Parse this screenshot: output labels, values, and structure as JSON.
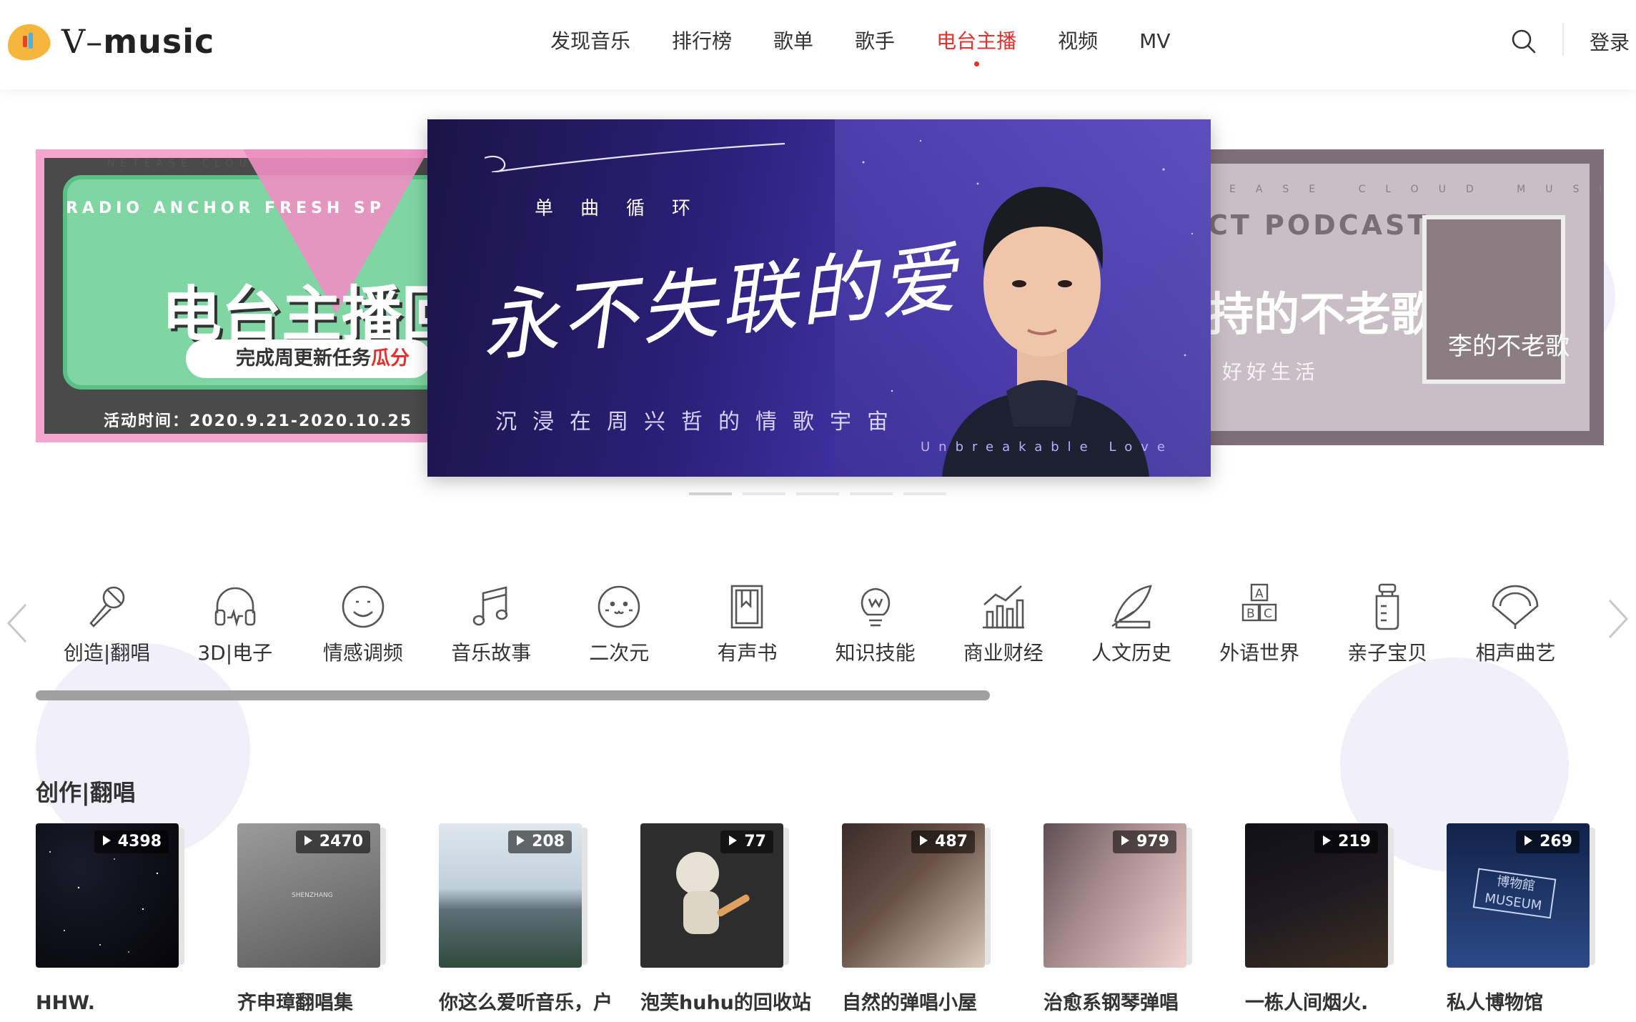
{
  "header": {
    "logo_text_a": "V–",
    "logo_text_b": "music",
    "nav": [
      {
        "label": "发现音乐",
        "active": false
      },
      {
        "label": "排行榜",
        "active": false
      },
      {
        "label": "歌单",
        "active": false
      },
      {
        "label": "歌手",
        "active": false
      },
      {
        "label": "电台主播",
        "active": true
      },
      {
        "label": "视频",
        "active": false
      },
      {
        "label": "MV",
        "active": false
      }
    ],
    "search_icon": "search-icon",
    "login_label": "登录"
  },
  "carousel": {
    "left": {
      "stripe": "NETEASE CLOUD MUSIC",
      "small": "RADIO ANCHOR FRESH SP",
      "big": "电台主播回",
      "pill_a": "完成周更新任务",
      "pill_b": "瓜分",
      "date": "活动时间：2020.9.21-2020.10.25"
    },
    "center": {
      "subtitle": "单曲循环",
      "title": "永不失联的爱",
      "tagline": "沉浸在周兴哲的情歌宇宙",
      "english": "Unbreakable Love"
    },
    "right": {
      "stripe": "EASE CLOUD MUSIC",
      "podcast": "CT PODCAST",
      "song": "持的不老歌",
      "life": "好好生活",
      "cover_text": "李的不老歌"
    },
    "dots": 5,
    "active_dot": 0
  },
  "categories": [
    {
      "label": "创造|翻唱",
      "icon": "microphone-icon"
    },
    {
      "label": "3D|电子",
      "icon": "headphones-icon"
    },
    {
      "label": "情感调频",
      "icon": "smile-icon"
    },
    {
      "label": "音乐故事",
      "icon": "music-note-icon"
    },
    {
      "label": "二次元",
      "icon": "anime-face-icon"
    },
    {
      "label": "有声书",
      "icon": "book-icon"
    },
    {
      "label": "知识技能",
      "icon": "lightbulb-icon"
    },
    {
      "label": "商业财经",
      "icon": "chart-icon"
    },
    {
      "label": "人文历史",
      "icon": "quill-icon"
    },
    {
      "label": "外语世界",
      "icon": "abc-blocks-icon"
    },
    {
      "label": "亲子宝贝",
      "icon": "bottle-icon"
    },
    {
      "label": "相声曲艺",
      "icon": "fan-icon"
    }
  ],
  "section": {
    "title": "创作|翻唱",
    "cards": [
      {
        "count": "4398",
        "title": "HHW.",
        "colors": [
          "#0b0b14",
          "#1a1a2a"
        ]
      },
      {
        "count": "2470",
        "title": "齐申璋翻唱集",
        "colors": [
          "#8c8c8c",
          "#5c5c5c"
        ],
        "cover_text": "SHENZHANG"
      },
      {
        "count": "208",
        "title": "你这么爱听音乐，户一打回",
        "colors": [
          "#c9d6e0",
          "#3e5a48"
        ]
      },
      {
        "count": "77",
        "title": "泡芙huhu的回收站",
        "colors": [
          "#2a2a2a",
          "#3a3a3a"
        ]
      },
      {
        "count": "487",
        "title": "自然的弹唱小屋",
        "colors": [
          "#3a2c28",
          "#c7b8a8"
        ]
      },
      {
        "count": "979",
        "title": "治愈系钢琴弹唱",
        "colors": [
          "#6a5a5e",
          "#e8c7c6"
        ]
      },
      {
        "count": "219",
        "title": "一栋人间烟火.",
        "colors": [
          "#15141a",
          "#3a2c1a"
        ]
      },
      {
        "count": "269",
        "title": "私人博物馆",
        "colors": [
          "#1c2f5e",
          "#3b5c9a"
        ],
        "cover_text": "博物館 MUSEUM"
      }
    ]
  },
  "colors": {
    "accent": "#e5302b",
    "text": "#333333",
    "banner_purple": "#2b1f78"
  }
}
